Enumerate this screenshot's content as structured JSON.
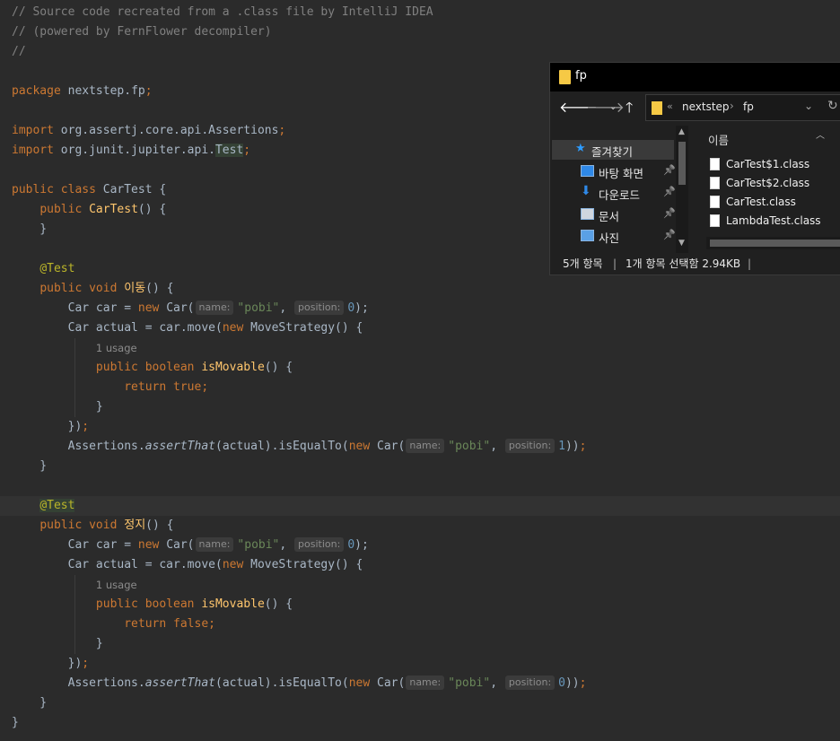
{
  "editor": {
    "lines": [
      [
        {
          "t": "// Source code recreated from a .class file by IntelliJ IDEA",
          "c": "comment"
        }
      ],
      [
        {
          "t": "// (powered by FernFlower decompiler)",
          "c": "comment"
        }
      ],
      [
        {
          "t": "//",
          "c": "comment"
        }
      ],
      [],
      [
        {
          "t": "package",
          "c": "kw"
        },
        {
          "t": " nextstep.fp"
        },
        {
          "t": ";",
          "c": "kw"
        }
      ],
      [],
      [
        {
          "t": "import",
          "c": "kw"
        },
        {
          "t": " org.assertj.core.api.Assertions"
        },
        {
          "t": ";",
          "c": "kw"
        }
      ],
      [
        {
          "t": "import",
          "c": "kw"
        },
        {
          "t": " org.junit.jupiter.api."
        },
        {
          "t": "Test",
          "c": "hl"
        },
        {
          "t": ";",
          "c": "kw"
        }
      ],
      [],
      [
        {
          "t": "public class",
          "c": "kw"
        },
        {
          "t": " CarTest {"
        }
      ],
      [
        {
          "t": "    "
        },
        {
          "t": "public",
          "c": "kw"
        },
        {
          "t": " "
        },
        {
          "t": "CarTest",
          "c": "fn"
        },
        {
          "t": "() {"
        }
      ],
      [
        {
          "t": "    }"
        }
      ],
      [],
      [
        {
          "t": "    "
        },
        {
          "t": "@Test",
          "c": "ann"
        }
      ],
      [
        {
          "t": "    "
        },
        {
          "t": "public void",
          "c": "kw"
        },
        {
          "t": " "
        },
        {
          "t": "이동",
          "c": "fn"
        },
        {
          "t": "() {"
        }
      ],
      [
        {
          "t": "        Car car = "
        },
        {
          "t": "new",
          "c": "kw"
        },
        {
          "t": " Car("
        },
        {
          "t": "name:",
          "c": "hint"
        },
        {
          "t": "\"pobi\"",
          "c": "str"
        },
        {
          "t": ", "
        },
        {
          "t": "position:",
          "c": "hint"
        },
        {
          "t": "0",
          "c": "num"
        },
        {
          "t": ");"
        }
      ],
      [
        {
          "t": "        Car actual = car.move("
        },
        {
          "t": "new",
          "c": "kw"
        },
        {
          "t": " MoveStrategy() {"
        }
      ],
      [
        {
          "t": "            "
        },
        {
          "t": "1 usage",
          "c": "lens"
        }
      ],
      [
        {
          "t": "            "
        },
        {
          "t": "public boolean",
          "c": "kw"
        },
        {
          "t": " "
        },
        {
          "t": "isMovable",
          "c": "fn"
        },
        {
          "t": "() {"
        }
      ],
      [
        {
          "t": "                "
        },
        {
          "t": "return true",
          "c": "kw"
        },
        {
          "t": ";",
          "c": "kw"
        }
      ],
      [
        {
          "t": "            }"
        }
      ],
      [
        {
          "t": "        })"
        },
        {
          "t": ";",
          "c": "kw"
        }
      ],
      [
        {
          "t": "        Assertions."
        },
        {
          "t": "assertThat",
          "c": "italic"
        },
        {
          "t": "(actual).isEqualTo("
        },
        {
          "t": "new",
          "c": "kw"
        },
        {
          "t": " Car("
        },
        {
          "t": "name:",
          "c": "hint"
        },
        {
          "t": "\"pobi\"",
          "c": "str"
        },
        {
          "t": ", "
        },
        {
          "t": "position:",
          "c": "hint"
        },
        {
          "t": "1",
          "c": "num"
        },
        {
          "t": "))"
        },
        {
          "t": ";",
          "c": "kw"
        }
      ],
      [
        {
          "t": "    }"
        }
      ],
      [],
      [
        {
          "t": "    "
        },
        {
          "t": "@Test",
          "c": "ann hl"
        }
      ],
      [
        {
          "t": "    "
        },
        {
          "t": "public void",
          "c": "kw"
        },
        {
          "t": " "
        },
        {
          "t": "정지",
          "c": "fn"
        },
        {
          "t": "() {"
        }
      ],
      [
        {
          "t": "        Car car = "
        },
        {
          "t": "new",
          "c": "kw"
        },
        {
          "t": " Car("
        },
        {
          "t": "name:",
          "c": "hint"
        },
        {
          "t": "\"pobi\"",
          "c": "str"
        },
        {
          "t": ", "
        },
        {
          "t": "position:",
          "c": "hint"
        },
        {
          "t": "0",
          "c": "num"
        },
        {
          "t": ");"
        }
      ],
      [
        {
          "t": "        Car actual = car.move("
        },
        {
          "t": "new",
          "c": "kw"
        },
        {
          "t": " MoveStrategy() {"
        }
      ],
      [
        {
          "t": "            "
        },
        {
          "t": "1 usage",
          "c": "lens"
        }
      ],
      [
        {
          "t": "            "
        },
        {
          "t": "public boolean",
          "c": "kw"
        },
        {
          "t": " "
        },
        {
          "t": "isMovable",
          "c": "fn"
        },
        {
          "t": "() {"
        }
      ],
      [
        {
          "t": "                "
        },
        {
          "t": "return false",
          "c": "kw"
        },
        {
          "t": ";",
          "c": "kw"
        }
      ],
      [
        {
          "t": "            }"
        }
      ],
      [
        {
          "t": "        })"
        },
        {
          "t": ";",
          "c": "kw"
        }
      ],
      [
        {
          "t": "        Assertions."
        },
        {
          "t": "assertThat",
          "c": "italic"
        },
        {
          "t": "(actual).isEqualTo("
        },
        {
          "t": "new",
          "c": "kw"
        },
        {
          "t": " Car("
        },
        {
          "t": "name:",
          "c": "hint"
        },
        {
          "t": "\"pobi\"",
          "c": "str"
        },
        {
          "t": ", "
        },
        {
          "t": "position:",
          "c": "hint"
        },
        {
          "t": "0",
          "c": "num"
        },
        {
          "t": "))"
        },
        {
          "t": ";",
          "c": "kw"
        }
      ],
      [
        {
          "t": "    }"
        }
      ],
      [
        {
          "t": "}"
        }
      ]
    ],
    "highlighted_line": 25,
    "colors": {
      "background": "#2b2b2b",
      "keyword": "#cc7832",
      "string": "#6a8759",
      "number": "#6897bb",
      "comment": "#808080",
      "annotation": "#bbb529",
      "function": "#ffc66d"
    }
  },
  "explorer": {
    "title": "fp",
    "nav": {
      "back_icon": "arrow-left-icon",
      "forward_icon": "arrow-right-icon",
      "dropdown_icon": "chevron-down-icon",
      "up_icon": "arrow-up-icon"
    },
    "address": {
      "chevron": "«",
      "parts": [
        "nextstep",
        "fp"
      ],
      "separator": "›"
    },
    "nav_pane": [
      {
        "label": "즐겨찾기",
        "icon": "star-icon",
        "selected": true,
        "pinned": false
      },
      {
        "label": "바탕 화면",
        "icon": "desktop-icon",
        "selected": false,
        "pinned": true
      },
      {
        "label": "다운로드",
        "icon": "download-icon",
        "selected": false,
        "pinned": true
      },
      {
        "label": "문서",
        "icon": "document-icon",
        "selected": false,
        "pinned": true
      },
      {
        "label": "사진",
        "icon": "picture-icon",
        "selected": false,
        "pinned": true
      }
    ],
    "list_header": "이름",
    "files": [
      "CarTest$1.class",
      "CarTest$2.class",
      "CarTest.class",
      "LambdaTest.class"
    ],
    "status": {
      "count": "5개 항목",
      "selected": "1개 항목 선택함 2.94KB"
    }
  }
}
